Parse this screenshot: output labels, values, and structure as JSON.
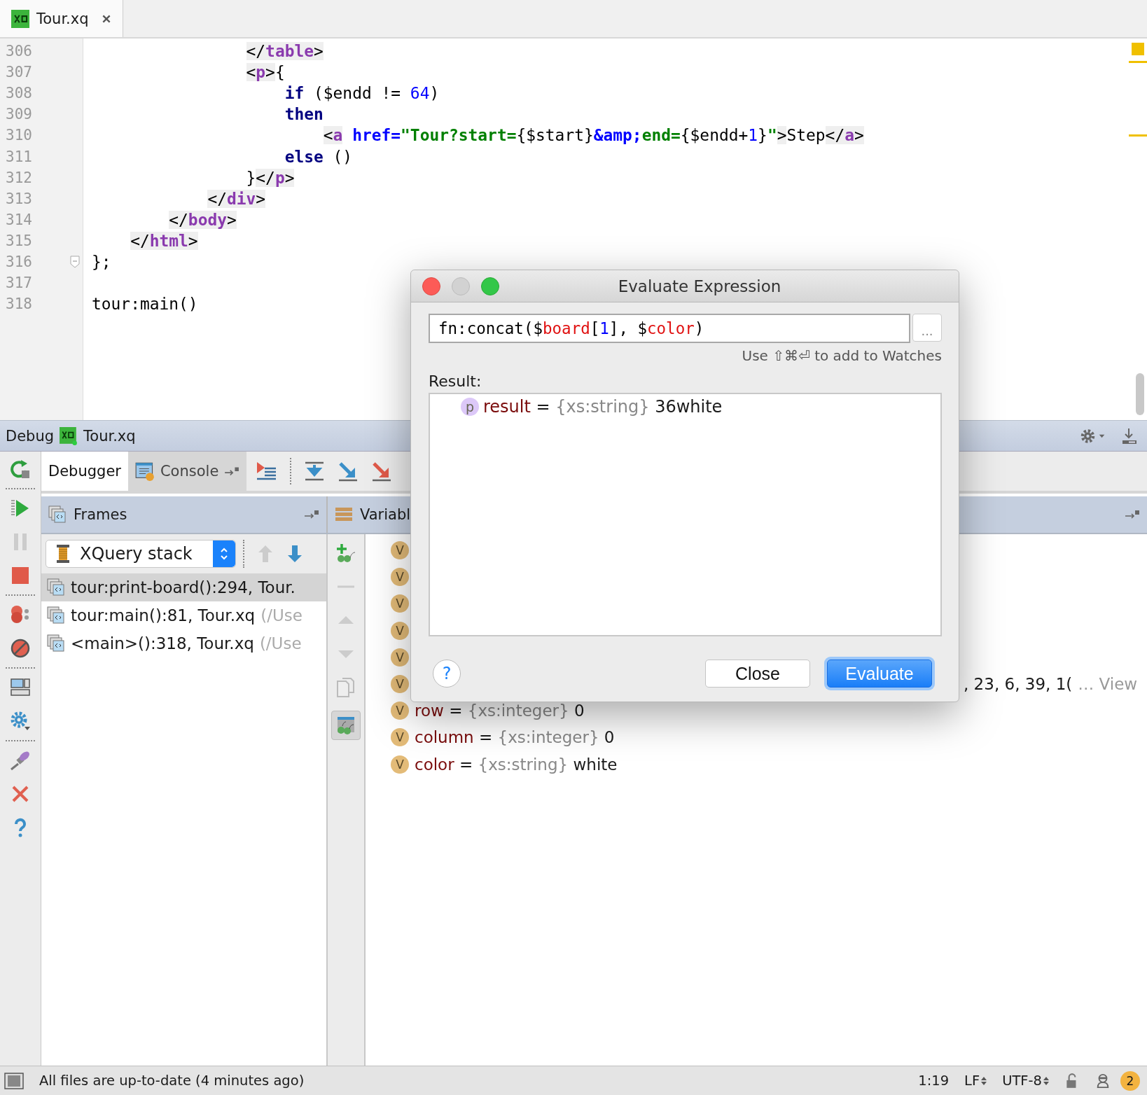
{
  "tab": {
    "label": "Tour.xq",
    "selected": true
  },
  "editor": {
    "lines": [
      {
        "number": "306",
        "fold_marker": false,
        "segments": [
          {
            "kind": "tagpunct",
            "text": "                </"
          },
          {
            "kind": "tag",
            "text": "table"
          },
          {
            "kind": "tagpunct",
            "text": ">"
          }
        ]
      },
      {
        "number": "307",
        "fold_marker": false,
        "segments": [
          {
            "kind": "tagpunct",
            "text": "                <"
          },
          {
            "kind": "tag",
            "text": "p"
          },
          {
            "kind": "tagpunct",
            "text": ">"
          },
          {
            "kind": "plain",
            "text": "{"
          }
        ]
      },
      {
        "number": "308",
        "fold_marker": false,
        "segments": [
          {
            "kind": "keyword",
            "text": "                    if"
          },
          {
            "kind": "plain",
            "text": " ($endd != "
          },
          {
            "kind": "number",
            "text": "64"
          },
          {
            "kind": "plain",
            "text": ")"
          }
        ]
      },
      {
        "number": "309",
        "fold_marker": false,
        "segments": [
          {
            "kind": "keyword",
            "text": "                    then"
          }
        ]
      },
      {
        "number": "310",
        "fold_marker": false,
        "segments": [
          {
            "kind": "tagpunct",
            "text": "                        <"
          },
          {
            "kind": "tag",
            "text": "a"
          },
          {
            "kind": "attr",
            "text": " href="
          },
          {
            "kind": "string",
            "text": "\"Tour?start="
          },
          {
            "kind": "plain",
            "text": "{$start}"
          },
          {
            "kind": "entity",
            "text": "&amp;"
          },
          {
            "kind": "string",
            "text": "end="
          },
          {
            "kind": "plain",
            "text": "{$endd+"
          },
          {
            "kind": "number",
            "text": "1"
          },
          {
            "kind": "plain",
            "text": "}"
          },
          {
            "kind": "string",
            "text": "\""
          },
          {
            "kind": "tagpunct",
            "text": ">"
          },
          {
            "kind": "plain",
            "text": "Step"
          },
          {
            "kind": "tagpunct",
            "text": "</"
          },
          {
            "kind": "tag",
            "text": "a"
          },
          {
            "kind": "tagpunct",
            "text": ">"
          }
        ]
      },
      {
        "number": "311",
        "fold_marker": false,
        "segments": [
          {
            "kind": "keyword",
            "text": "                    else"
          },
          {
            "kind": "plain",
            "text": " ()"
          }
        ]
      },
      {
        "number": "312",
        "fold_marker": false,
        "segments": [
          {
            "kind": "plain",
            "text": "                }"
          },
          {
            "kind": "tagpunct",
            "text": "</"
          },
          {
            "kind": "tag",
            "text": "p"
          },
          {
            "kind": "tagpunct",
            "text": ">"
          }
        ]
      },
      {
        "number": "313",
        "fold_marker": false,
        "segments": [
          {
            "kind": "tagpunct",
            "text": "            </"
          },
          {
            "kind": "tag",
            "text": "div"
          },
          {
            "kind": "tagpunct",
            "text": ">"
          }
        ]
      },
      {
        "number": "314",
        "fold_marker": false,
        "segments": [
          {
            "kind": "tagpunct",
            "text": "        </"
          },
          {
            "kind": "tag",
            "text": "body"
          },
          {
            "kind": "tagpunct",
            "text": ">"
          }
        ]
      },
      {
        "number": "315",
        "fold_marker": false,
        "segments": [
          {
            "kind": "tagpunct",
            "text": "    </"
          },
          {
            "kind": "tag",
            "text": "html"
          },
          {
            "kind": "tagpunct",
            "text": ">"
          }
        ]
      },
      {
        "number": "316",
        "fold_marker": true,
        "segments": [
          {
            "kind": "plain",
            "text": "};"
          }
        ]
      },
      {
        "number": "317",
        "fold_marker": false
      },
      {
        "number": "318",
        "fold_marker": false,
        "segments": [
          {
            "kind": "plain",
            "text": "tour:main()"
          }
        ]
      }
    ]
  },
  "debug": {
    "title": "Debug",
    "config": "Tour.xq",
    "tabs": [
      {
        "label": "Debugger",
        "selected": true
      },
      {
        "label": "Console",
        "selected": false
      }
    ],
    "frames": {
      "title": "Frames",
      "stack": "XQuery stack",
      "rows": [
        {
          "text": "tour:print-board():294, Tour.",
          "selected": true
        },
        {
          "text": "tour:main():81, Tour.xq",
          "path": "(/Use",
          "selected": false
        },
        {
          "text": "<main>():318, Tour.xq",
          "path": "(/Use",
          "selected": false
        }
      ]
    },
    "variables": {
      "title": "Variabl",
      "rows": [
        {
          "kind": "covered",
          "badge": "V"
        },
        {
          "kind": "covered",
          "badge": "V"
        },
        {
          "kind": "covered",
          "badge": "V"
        },
        {
          "kind": "covered",
          "badge": "V"
        },
        {
          "kind": "covered",
          "badge": "V"
        },
        {
          "kind": "tail",
          "badge": "V",
          "value": ", 23, 6, 39, 1(",
          "more": "… View"
        },
        {
          "kind": "full",
          "badge": "V",
          "name": "row",
          "separator": "=",
          "type": "{xs:integer}",
          "value": "0"
        },
        {
          "kind": "full",
          "badge": "V",
          "name": "column",
          "separator": "=",
          "type": "{xs:integer}",
          "value": "0"
        },
        {
          "kind": "full",
          "badge": "V",
          "name": "color",
          "separator": "=",
          "type": "{xs:string}",
          "value": "white"
        }
      ]
    }
  },
  "dialog": {
    "title": "Evaluate Expression",
    "expression": [
      {
        "kind": "plain",
        "text": "fn:concat($"
      },
      {
        "kind": "var",
        "text": "board"
      },
      {
        "kind": "plain",
        "text": "["
      },
      {
        "kind": "number",
        "text": "1"
      },
      {
        "kind": "plain",
        "text": "], $"
      },
      {
        "kind": "var",
        "text": "color"
      },
      {
        "kind": "plain",
        "text": ")"
      }
    ],
    "more_button": "...",
    "hint": "Use ⇧⌘⏎ to add to Watches",
    "result_label": "Result:",
    "result": {
      "badge": "p",
      "name": "result",
      "separator": "=",
      "type": "{xs:string}",
      "value": "36white"
    },
    "help": "?",
    "buttons": [
      {
        "label": "Close",
        "kind": "secondary"
      },
      {
        "label": "Evaluate",
        "kind": "primary"
      }
    ]
  },
  "status_bar": {
    "message": "All files are up-to-date (4 minutes ago)",
    "position": "1:19",
    "line_ending": "LF",
    "encoding": "UTF-8",
    "notifications": "2"
  }
}
